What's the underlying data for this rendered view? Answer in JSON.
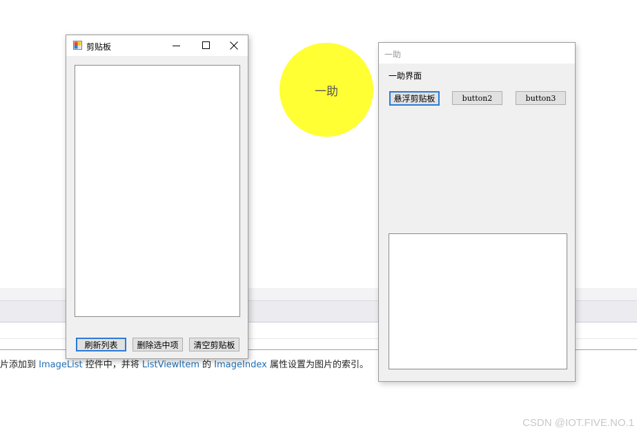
{
  "background": {
    "doc_text": {
      "part1": "片添加到 ",
      "code1": "ImageList",
      "part2": " 控件中，并将 ",
      "code2": "ListViewItem",
      "part3": " 的 ",
      "code3": "ImageIndex",
      "part4": " 属性设置为图片的索引。"
    },
    "watermark": "CSDN @IOT.FIVE.NO.1"
  },
  "float_ball": {
    "label": "一助",
    "color": "#ffff33"
  },
  "clipboard_window": {
    "title": "剪贴板",
    "icon": "app-window-icon",
    "buttons": {
      "refresh": "刷新列表",
      "delete_selected": "删除选中项",
      "clear": "清空剪贴板"
    }
  },
  "assist_window": {
    "title": "一助",
    "label": "一助界面",
    "buttons": {
      "float_clipboard": "悬浮剪贴板",
      "button2": "button2",
      "button3": "button3"
    }
  },
  "colors": {
    "focus_border": "#2a7ad8",
    "link": "#1f6fb5"
  }
}
